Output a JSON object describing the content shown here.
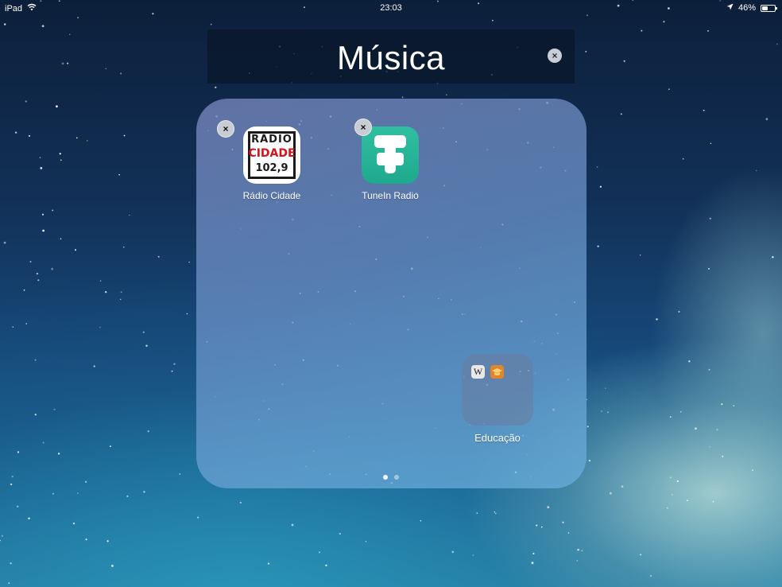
{
  "status_bar": {
    "device": "iPad",
    "time": "23:03",
    "battery": "46%",
    "battery_level": 0.46,
    "icons": [
      "wifi-icon",
      "location-arrow-icon",
      "battery-icon"
    ]
  },
  "folder": {
    "name": "Música",
    "clear_icon": "×",
    "apps": [
      {
        "label": "Rádio Cidade",
        "icon_text": [
          "RÁDIO",
          "CIDADE",
          "102,9"
        ],
        "icon_colors": {
          "text": "#1a1a1a",
          "accent": "#d5121b",
          "background": "#ffffff"
        },
        "delete_icon": "×"
      },
      {
        "label": "TuneIn Radio",
        "icon_colors": {
          "background": "#22b296",
          "glyph": "#ffffff"
        },
        "delete_icon": "×"
      }
    ],
    "subfolder": {
      "label": "Educação",
      "mini_apps": [
        {
          "glyph": "W",
          "icon": "wikipedia-icon"
        },
        {
          "icon": "education-app-icon"
        }
      ]
    },
    "pages": {
      "count": 2,
      "current": 1
    }
  }
}
